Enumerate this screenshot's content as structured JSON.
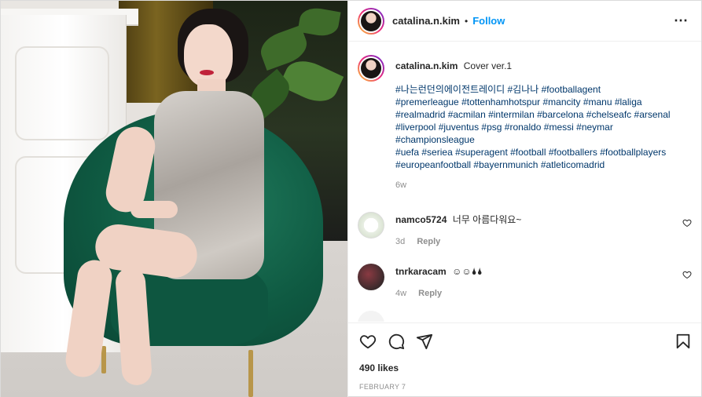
{
  "header": {
    "username": "catalina.n.kim",
    "separator": "•",
    "follow_label": "Follow",
    "more_label": "⋯"
  },
  "caption": {
    "username": "catalina.n.kim",
    "text": "Cover ver.1",
    "hashtag_lines": [
      "#나는런던의에이전트레이디 #김나나 #footballagent",
      "#premerleague #tottenhamhotspur #mancity #manu #laliga",
      "#realmadrid #acmilan #intermilan #barcelona #chelseafc #arsenal",
      "#liverpool #juventus #psg #ronaldo #messi #neymar",
      "#championsleague",
      "#uefa #seriea #superagent #football #footballers #footballplayers",
      "#europeanfootball #bayernmunich #atleticomadrid"
    ],
    "age": "6w"
  },
  "comments": [
    {
      "username": "namco5724",
      "text": "너무 아름다워요~",
      "age": "3d",
      "reply_label": "Reply"
    },
    {
      "username": "tnrkaracam",
      "text": "☺☺🌢🌢",
      "age": "4w",
      "reply_label": "Reply"
    }
  ],
  "icons": [
    "heart-icon",
    "comment-icon",
    "share-icon",
    "bookmark-icon",
    "more-icon"
  ],
  "likes": "490 likes",
  "date": "FEBRUARY 7",
  "colors": {
    "link": "#0095f6",
    "hashtag": "#00376b",
    "muted": "#8e8e8e"
  }
}
